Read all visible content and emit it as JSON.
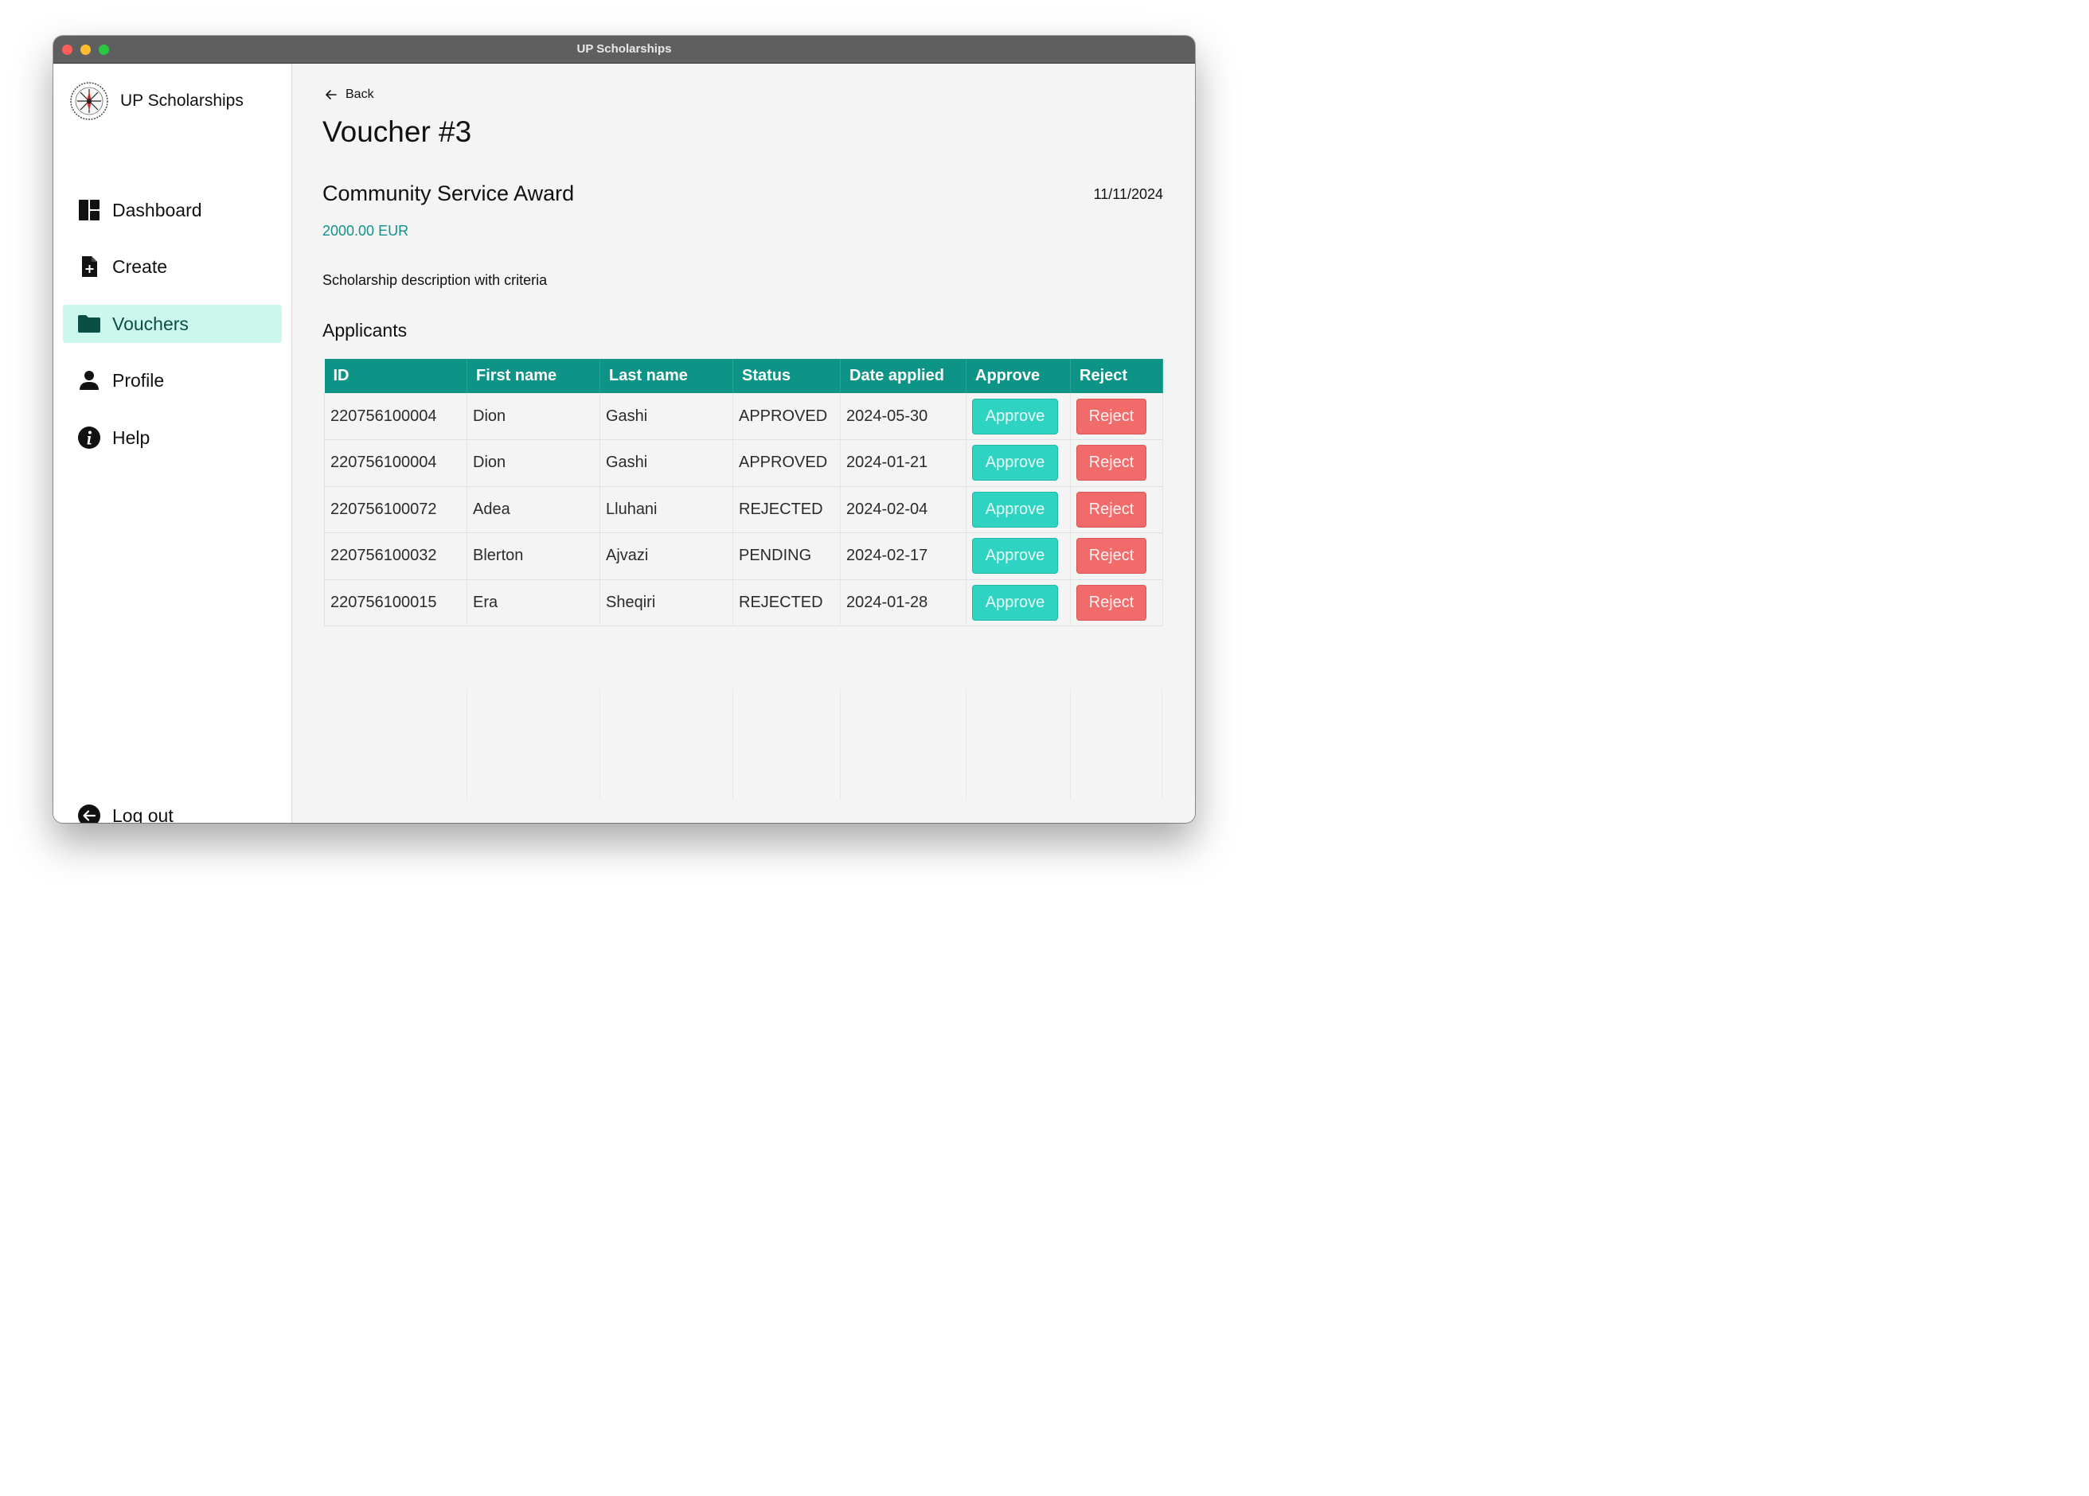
{
  "window": {
    "title": "UP Scholarships"
  },
  "sidebar": {
    "brand_name": "UP Scholarships",
    "items": [
      {
        "label": "Dashboard",
        "icon": "dashboard-icon"
      },
      {
        "label": "Create",
        "icon": "file-add-icon"
      },
      {
        "label": "Vouchers",
        "icon": "folder-icon",
        "active": true
      },
      {
        "label": "Profile",
        "icon": "person-icon"
      },
      {
        "label": "Help",
        "icon": "info-icon"
      }
    ],
    "logout_label": "Log out"
  },
  "main": {
    "back_label": "Back",
    "page_title": "Voucher #3",
    "award_title": "Community Service Award",
    "date": "11/11/2024",
    "amount": "2000.00 EUR",
    "description": "Scholarship description with criteria",
    "applicants_heading": "Applicants"
  },
  "table": {
    "columns": [
      "ID",
      "First name",
      "Last name",
      "Status",
      "Date applied",
      "Approve",
      "Reject"
    ],
    "approve_label": "Approve",
    "reject_label": "Reject",
    "rows": [
      {
        "id": "220756100004",
        "first": "Dion",
        "last": "Gashi",
        "status": "APPROVED",
        "date": "2024-05-30"
      },
      {
        "id": "220756100004",
        "first": "Dion",
        "last": "Gashi",
        "status": "APPROVED",
        "date": "2024-01-21"
      },
      {
        "id": "220756100072",
        "first": "Adea",
        "last": "Lluhani",
        "status": "REJECTED",
        "date": "2024-02-04"
      },
      {
        "id": "220756100032",
        "first": "Blerton",
        "last": "Ajvazi",
        "status": "PENDING",
        "date": "2024-02-17"
      },
      {
        "id": "220756100015",
        "first": "Era",
        "last": "Sheqiri",
        "status": "REJECTED",
        "date": "2024-01-28"
      }
    ]
  },
  "colors": {
    "accent": "#0e9387",
    "active_nav_bg": "#cbf7ec",
    "approve": "#2fd3c2",
    "reject": "#f26b6b"
  }
}
